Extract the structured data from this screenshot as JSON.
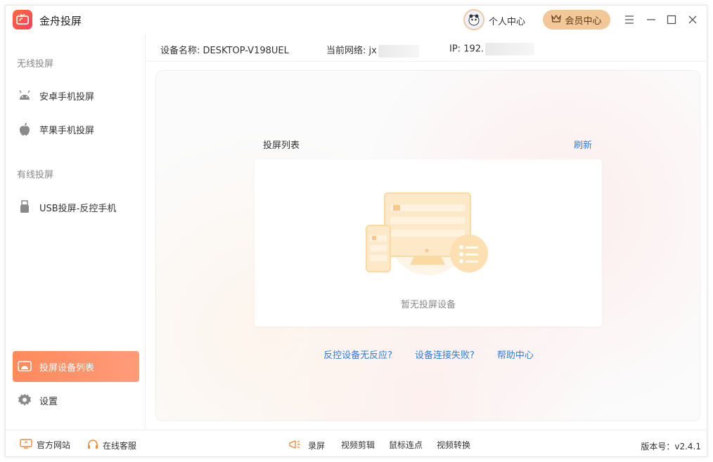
{
  "app": {
    "title": "金舟投屏"
  },
  "header": {
    "personal_label": "个人中心",
    "vip_label": "会员中心"
  },
  "sidebar": {
    "sections": [
      {
        "label": "无线投屏"
      },
      {
        "label": "有线投屏"
      }
    ],
    "items": [
      {
        "label": "安卓手机投屏",
        "icon": "android-icon"
      },
      {
        "label": "苹果手机投屏",
        "icon": "apple-icon"
      },
      {
        "label": "USB投屏-反控手机",
        "icon": "usb-icon"
      },
      {
        "label": "投屏设备列表",
        "icon": "screen-list-icon",
        "active": true
      },
      {
        "label": "设置",
        "icon": "gear-icon"
      }
    ]
  },
  "info": {
    "device_label": "设备名称:",
    "device_value": "DESKTOP-V198UEL",
    "network_label": "当前网络:",
    "network_value": "jx",
    "ip_label": "IP:",
    "ip_value": "192."
  },
  "main": {
    "list_title": "投屏列表",
    "refresh": "刷新",
    "empty_text": "暂无投屏设备",
    "links": [
      "反控设备无反应?",
      "设备连接失败?",
      "帮助中心"
    ]
  },
  "footer": {
    "official_site": "官方网站",
    "online_service": "在线客服",
    "tools": [
      "录屏",
      "视频剪辑",
      "鼠标连点",
      "视频转换"
    ],
    "version": "版本号：v2.4.1"
  },
  "colors": {
    "accent": "#ff8a5c",
    "link": "#2f7de1",
    "vip_bg": "#f3c797"
  }
}
